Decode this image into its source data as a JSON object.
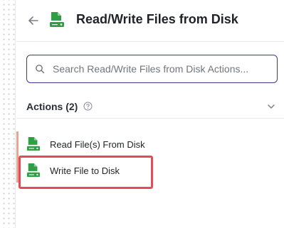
{
  "header": {
    "back_icon": "arrow-left-icon",
    "app_icon": "file-disk-icon",
    "title": "Read/Write Files from Disk"
  },
  "search": {
    "icon": "search-icon",
    "placeholder": "Search Read/Write Files from Disk Actions...",
    "value": ""
  },
  "section": {
    "title": "Actions (2)",
    "help_icon": "help-circle-icon",
    "toggle_icon": "chevron-down-icon",
    "expanded": true
  },
  "actions": [
    {
      "label": "Read File(s) From Disk",
      "icon": "file-disk-icon"
    },
    {
      "label": "Write File to Disk",
      "icon": "file-disk-icon",
      "highlighted": true
    }
  ],
  "colors": {
    "brand_green": "#2f9e44",
    "search_border": "#3b3b8f",
    "highlight_border": "#e24b57",
    "active_indicator": "#f0a291"
  }
}
